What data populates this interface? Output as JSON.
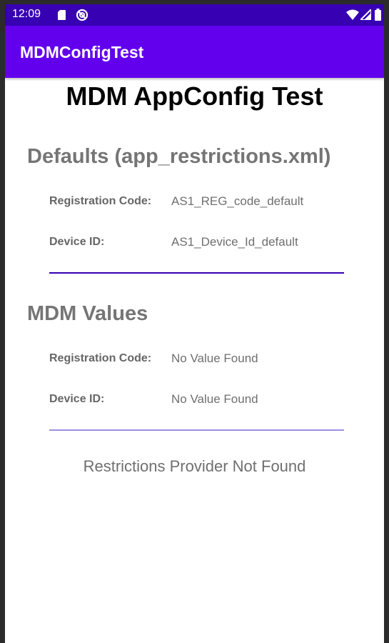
{
  "status_bar": {
    "time": "12:09",
    "icons": [
      "sd-card-icon",
      "sync-disabled-icon",
      "wifi-icon",
      "cell-signal-icon",
      "battery-icon"
    ]
  },
  "app_bar": {
    "title": "MDMConfigTest"
  },
  "page": {
    "title": "MDM AppConfig Test"
  },
  "defaults": {
    "heading": "Defaults (app_restrictions.xml)",
    "registration_label": "Registration Code:",
    "registration_value": "AS1_REG_code_default",
    "device_label": "Device ID:",
    "device_value": "AS1_Device_Id_default"
  },
  "mdm": {
    "heading": "MDM Values",
    "registration_label": "Registration Code:",
    "registration_value": "No Value Found",
    "device_label": "Device ID:",
    "device_value": "No Value Found"
  },
  "message": "Restrictions Provider Not Found",
  "colors": {
    "status_bar": "#3700b3",
    "app_bar": "#6200ee",
    "divider_primary": "#3700b3",
    "divider_secondary": "#9c8fe0"
  }
}
